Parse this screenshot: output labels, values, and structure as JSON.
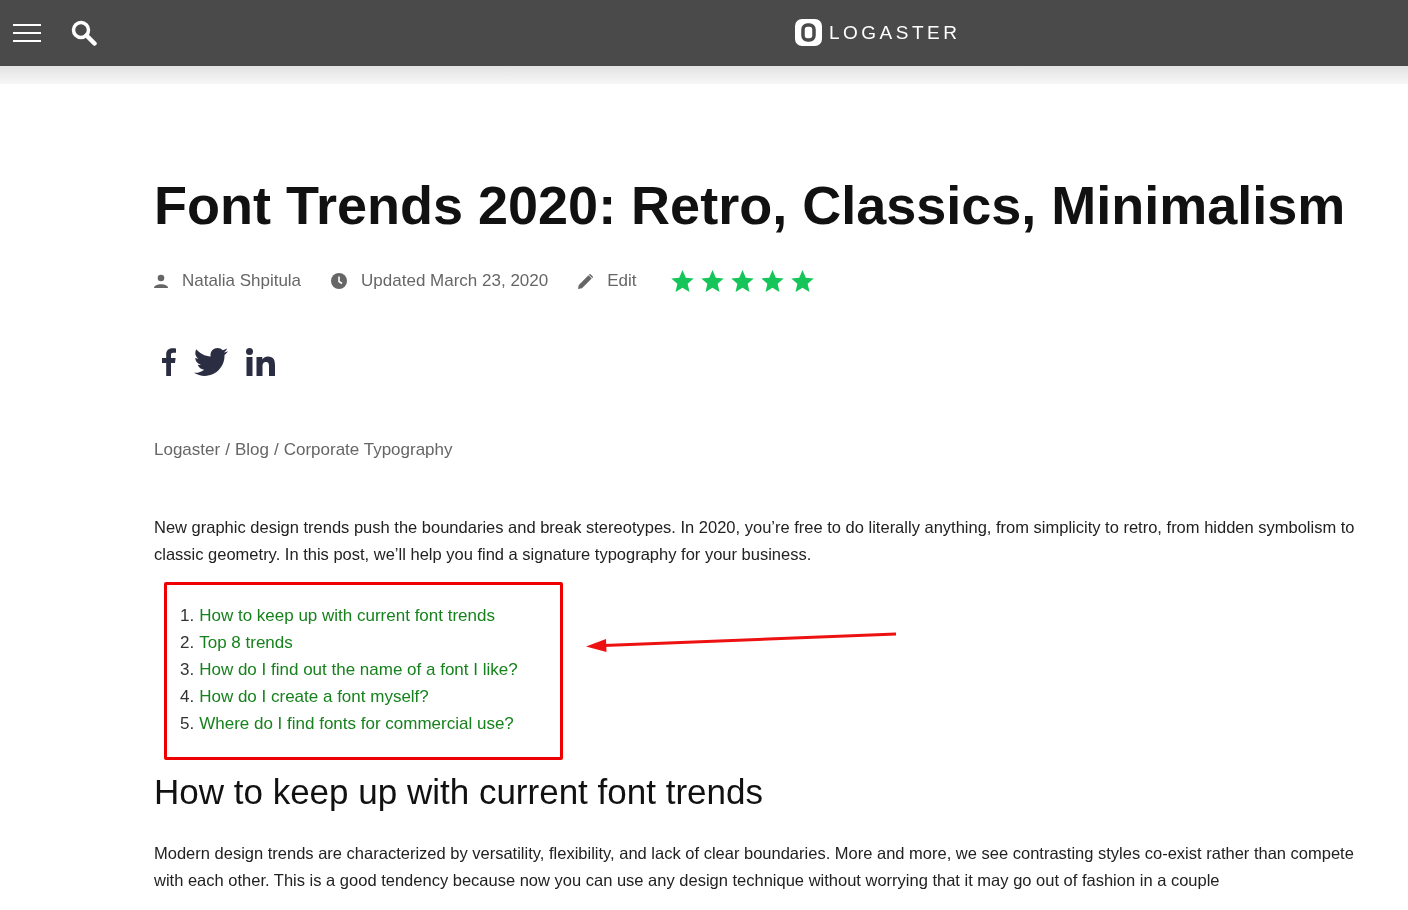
{
  "header": {
    "logo_text": "LOGASTER"
  },
  "article": {
    "title": "Font Trends 2020: Retro, Classics, Minimalism",
    "meta": {
      "author": "Natalia Shpitula",
      "updated": "Updated March 23, 2020",
      "edit": "Edit",
      "stars": 5
    },
    "breadcrumbs": [
      "Logaster",
      "Blog",
      "Corporate Typography"
    ],
    "breadcrumb_separator": "/",
    "intro": "New graphic design trends push the boundaries and break stereotypes. In 2020, you’re free to do literally anything, from simplicity to retro, from hidden symbolism to classic geometry. In this post, we’ll help you find a signature typography for your business.",
    "toc": [
      {
        "number": "1.",
        "label": "How to keep up with current font trends"
      },
      {
        "number": "2.",
        "label": "Top 8 trends"
      },
      {
        "number": "3.",
        "label": "How do I find out the name of a font I like?"
      },
      {
        "number": "4.",
        "label": "How do I create a font myself?"
      },
      {
        "number": "5.",
        "label": "Where do I find fonts for commercial use?"
      }
    ],
    "heading": "How to keep up with current font trends",
    "paragraph": "Modern design trends are characterized by versatility, flexibility, and lack of clear boundaries. More and more, we see contrasting styles co-exist rather than compete with each other. This is a good tendency because now you can use any design technique without worrying that it may go out of fashion in a couple"
  }
}
